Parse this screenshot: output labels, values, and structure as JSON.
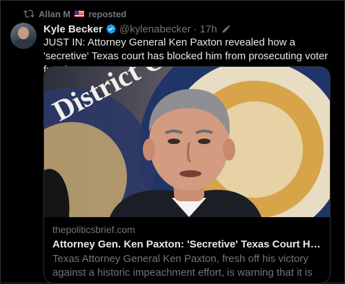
{
  "repost": {
    "user": "Allan M",
    "flag_icon": "us-flag-icon",
    "label": "reposted"
  },
  "tweet": {
    "display_name": "Kyle Becker",
    "handle": "@kylenabecker",
    "separator": "·",
    "time": "17h",
    "text": "JUST IN: Attorney General Ken Paxton revealed how a 'secretive' Texas court has blocked him from prosecuting voter fraud"
  },
  "card": {
    "image_text": "District Office",
    "domain": "thepoliticsbrief.com",
    "title": "Attorney Gen. Ken Paxton: 'Secretive' Texas Court Has Bloc...",
    "description": "Texas Attorney General Ken Paxton, fresh off his victory against a historic impeachment effort, is warning that it is ..."
  },
  "colors": {
    "background": "#000000",
    "text_primary": "#e7e9ea",
    "text_secondary": "#71767b",
    "verified_blue": "#1d9bf0",
    "border": "#2f3336"
  }
}
